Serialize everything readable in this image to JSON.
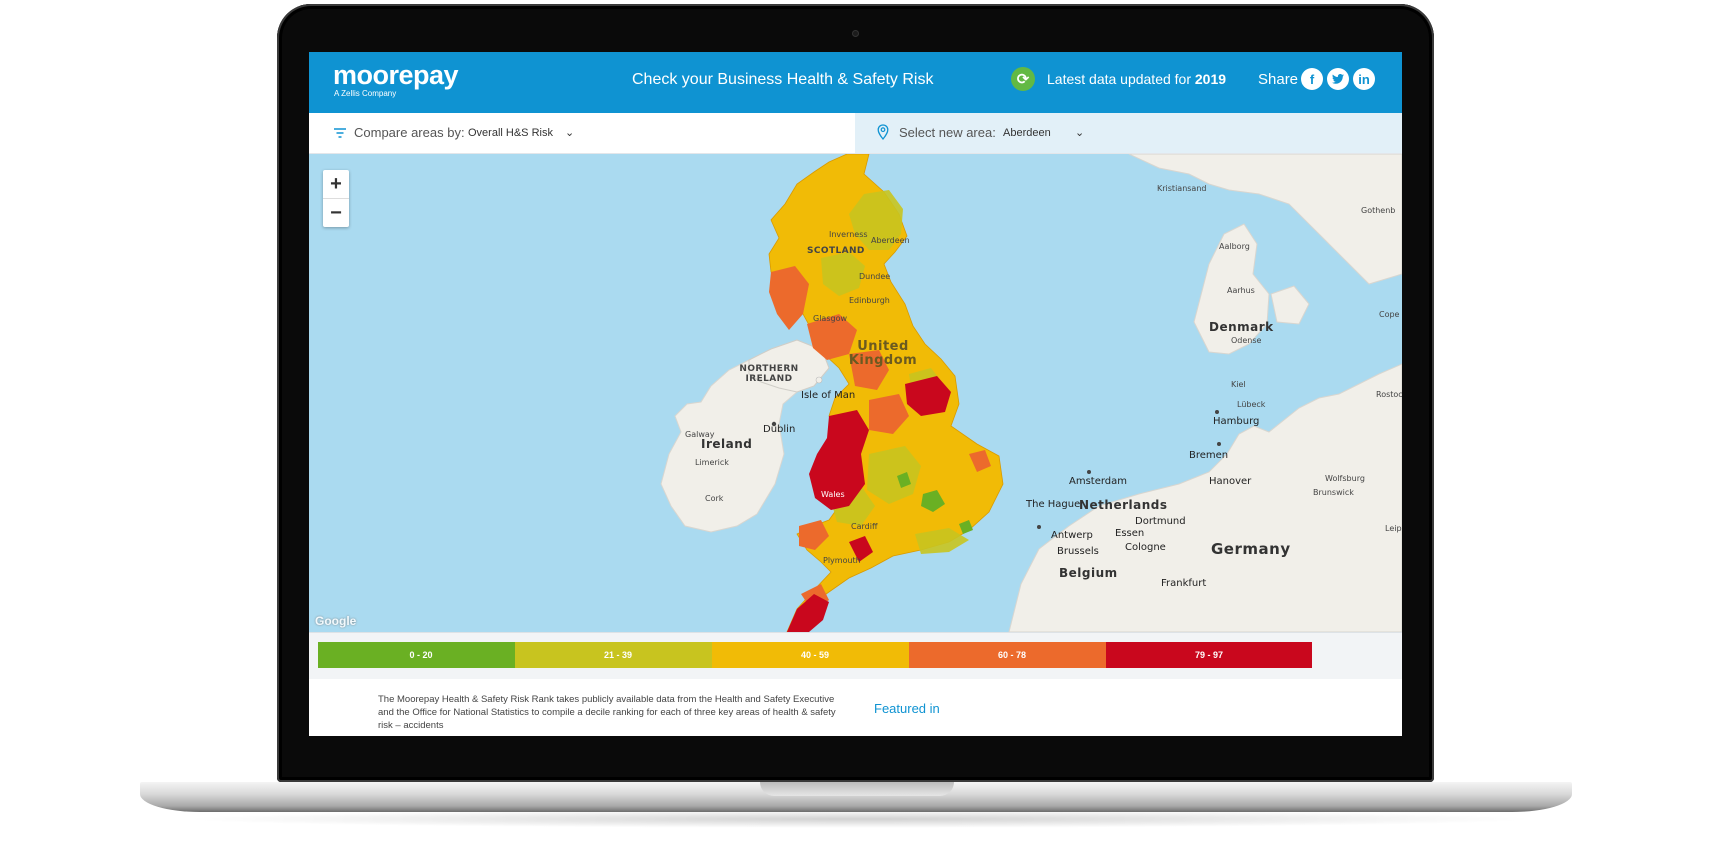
{
  "header": {
    "logo_text": "moorepay",
    "logo_subtext": "A Zellis Company",
    "title": "Check your Business Health & Safety Risk",
    "update_prefix": "Latest data updated for",
    "update_year": "2019",
    "share_label": "Share",
    "social": [
      "f",
      "t",
      "in"
    ]
  },
  "controls": {
    "compare_label": "Compare areas by:",
    "compare_value": "Overall H&S Risk",
    "area_label": "Select new area:",
    "area_value": "Aberdeen"
  },
  "map": {
    "zoom_in": "+",
    "zoom_out": "−",
    "attribution": "Google",
    "labels": {
      "kristiansand": "Kristiansand",
      "gothenburg": "Gothenb",
      "aalborg": "Aalborg",
      "aarhus": "Aarhus",
      "cope": "Cope",
      "denmark": "Denmark",
      "odense": "Odense",
      "kiel": "Kiel",
      "lubeck": "Lübeck",
      "rostock": "Rostoc",
      "hamburg": "Hamburg",
      "bremen": "Bremen",
      "hanover": "Hanover",
      "wolfsburg": "Wolfsburg",
      "brunswick": "Brunswick",
      "amsterdam": "Amsterdam",
      "the_hague": "The Hague",
      "netherlands": "Netherlands",
      "dortmund": "Dortmund",
      "essen": "Essen",
      "antwerp": "Antwerp",
      "cologne": "Cologne",
      "germany": "Germany",
      "leip": "Leip",
      "brussels": "Brussels",
      "belgium": "Belgium",
      "frankfurt": "Frankfurt",
      "northern_ireland": "NORTHERN\nIRELAND",
      "isle_of_man": "Isle of Man",
      "dublin": "Dublin",
      "galway": "Galway",
      "ireland": "Ireland",
      "limerick": "Limerick",
      "cork": "Cork",
      "scotland": "SCOTLAND",
      "united_kingdom": "United\nKingdom",
      "aberdeen": "Aberdeen",
      "dundee": "Dundee",
      "edinburgh": "Edinburgh",
      "glasgow": "Glasgow",
      "wales": "Wales",
      "cardiff": "Cardiff",
      "plymouth": "Plymouth",
      "inverness": "Inverness"
    },
    "colors": {
      "sea": "#aadaf0",
      "land": "#f1efe9",
      "risk_0_20": "#6ab023",
      "risk_21_39": "#c8c41f",
      "risk_40_59": "#f1bb06",
      "risk_60_78": "#ec6a2c",
      "risk_79_97": "#c9071d"
    }
  },
  "legend": [
    {
      "label": "0 - 20",
      "color": "#6ab023"
    },
    {
      "label": "21 - 39",
      "color": "#c8c41f"
    },
    {
      "label": "40 - 59",
      "color": "#f1bb06"
    },
    {
      "label": "60 - 78",
      "color": "#ec6a2c"
    },
    {
      "label": "79 - 97",
      "color": "#c9071d"
    }
  ],
  "content": {
    "description": "The Moorepay Health & Safety Risk Rank takes publicly available data from the Health and Safety Executive and the Office for National Statistics to compile a decile ranking for each of three key areas of health & safety risk – accidents",
    "featured_in": "Featured in"
  }
}
